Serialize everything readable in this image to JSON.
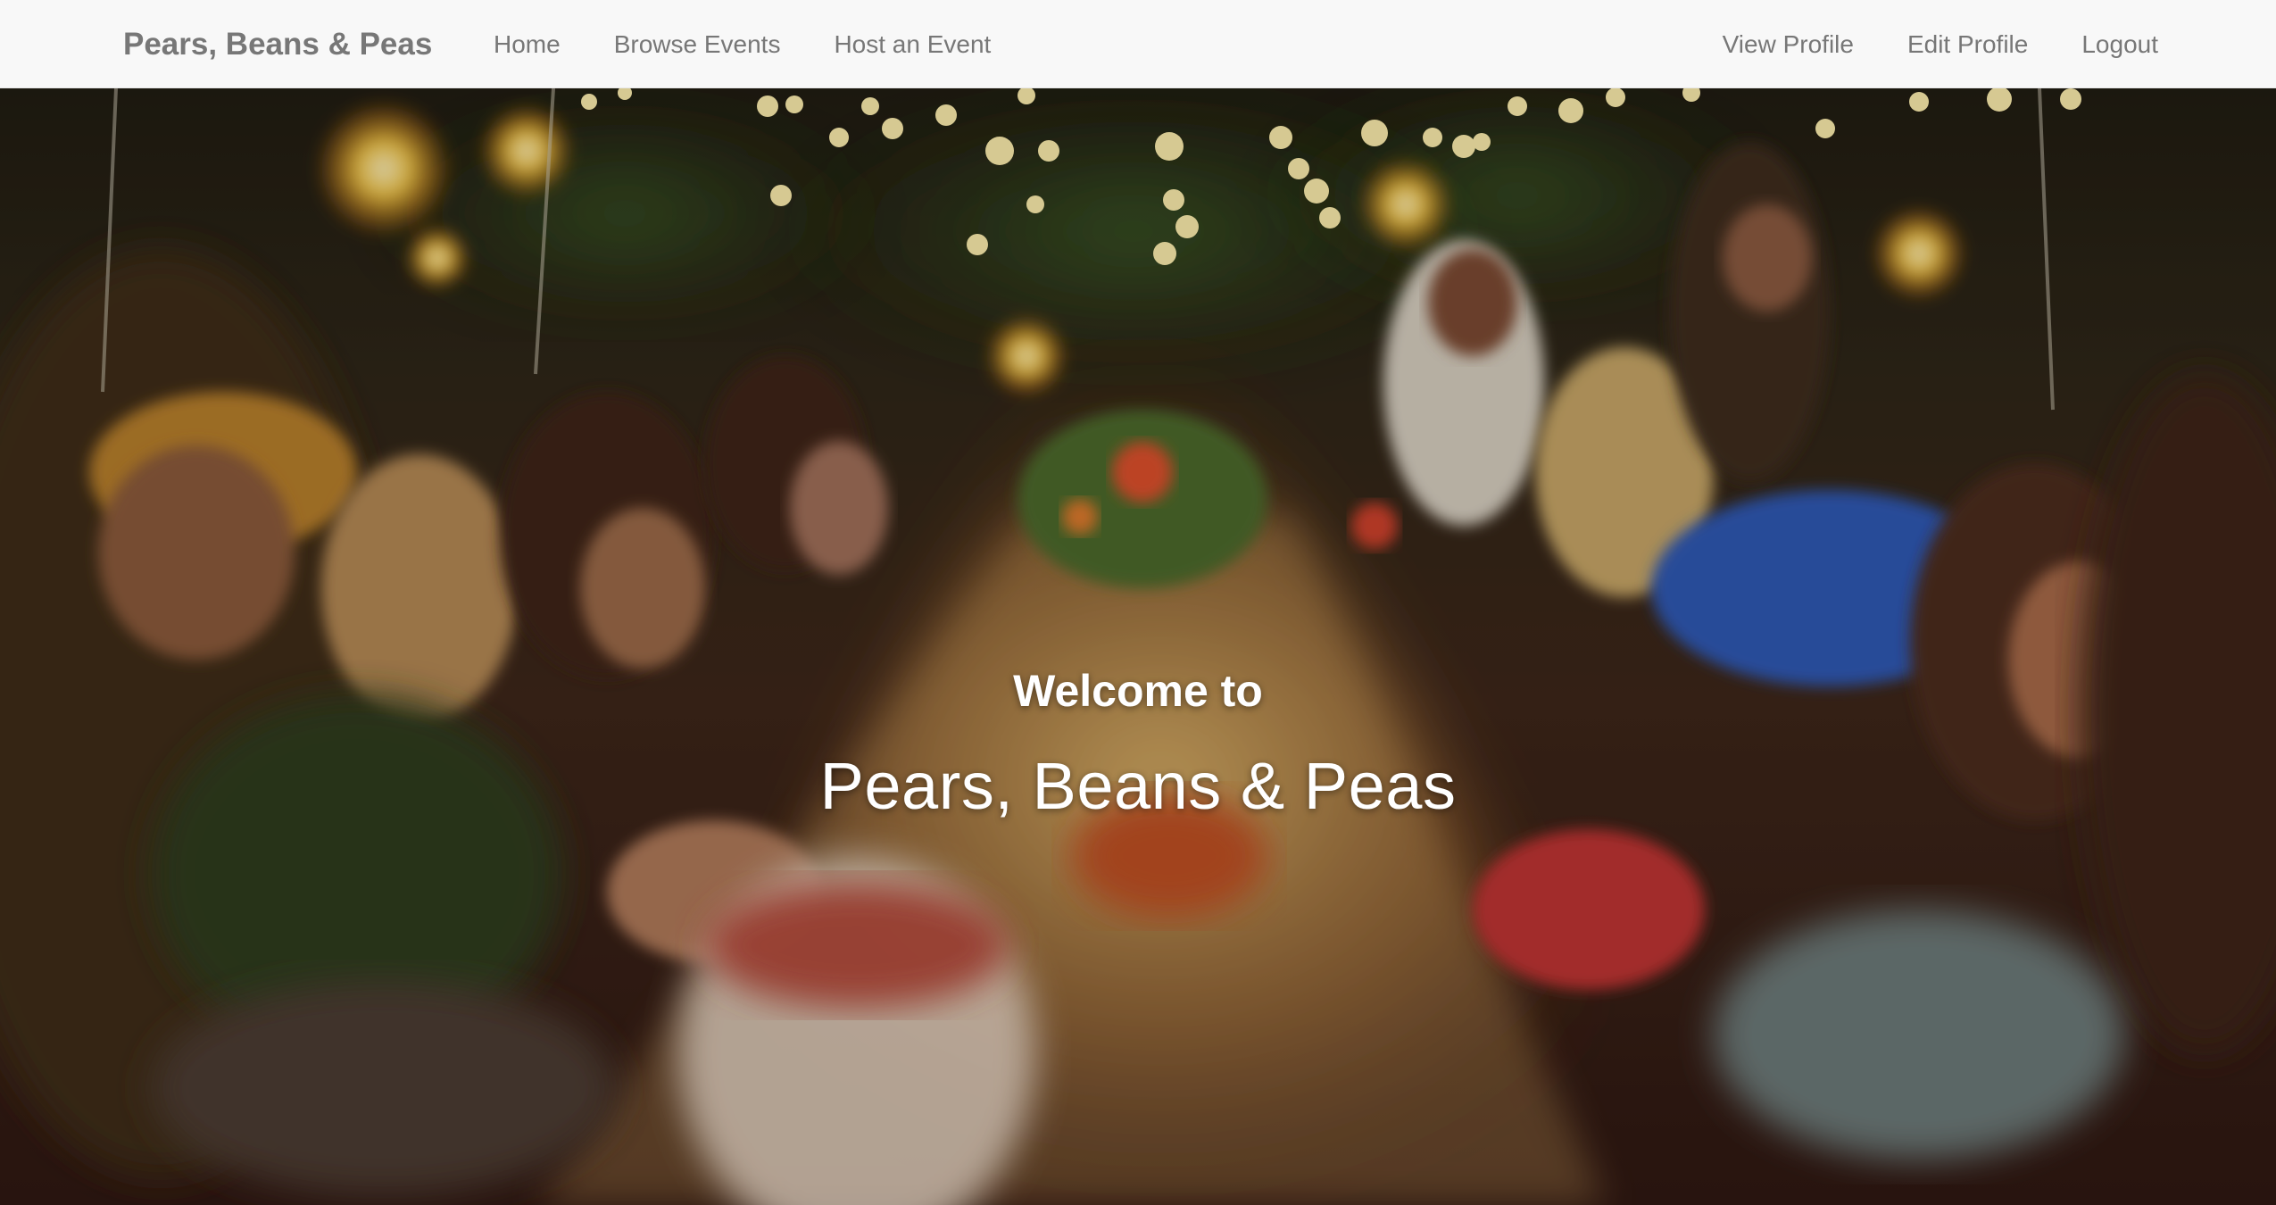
{
  "navbar": {
    "brand": "Pears, Beans & Peas",
    "left_links": [
      {
        "label": "Home"
      },
      {
        "label": "Browse Events"
      },
      {
        "label": "Host an Event"
      }
    ],
    "right_links": [
      {
        "label": "View Profile"
      },
      {
        "label": "Edit Profile"
      },
      {
        "label": "Logout"
      }
    ]
  },
  "hero": {
    "welcome": "Welcome to",
    "title": "Pears, Beans & Peas",
    "image": "outdoor-dinner-party-photo"
  },
  "colors": {
    "navbar_bg": "#f8f8f8",
    "nav_text": "#777777",
    "hero_text": "#ffffff"
  }
}
